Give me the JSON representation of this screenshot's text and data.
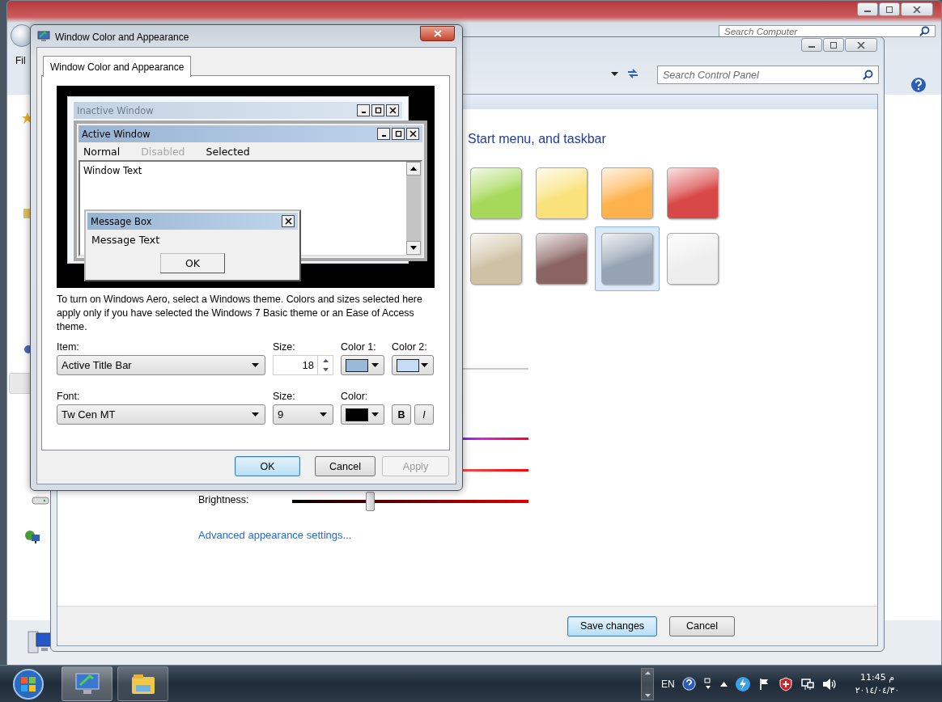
{
  "background_window": {
    "menu_partial": "Fil",
    "search": {
      "placeholder": "Search Computer"
    }
  },
  "control_panel": {
    "search": {
      "placeholder": "Search Control Panel"
    },
    "heading": "Start menu, and taskbar",
    "swatches": [
      {
        "color": "#a6d95a",
        "selected": false
      },
      {
        "color": "#f9e27a",
        "selected": false
      },
      {
        "color": "#fdb24e",
        "selected": false
      },
      {
        "color": "#d94848",
        "selected": false
      },
      {
        "color": "#cfc2a4",
        "selected": false
      },
      {
        "color": "#8a6462",
        "selected": false
      },
      {
        "color": "#95a3b3",
        "selected": true
      },
      {
        "color": "#eeeeee",
        "selected": false
      }
    ],
    "brightness": {
      "label": "Brightness:",
      "level": 0.33
    },
    "link": "Advanced appearance settings...",
    "buttons": [
      {
        "label": "Save changes",
        "default": true
      },
      {
        "label": "Cancel",
        "default": false
      }
    ]
  },
  "dialog": {
    "title": "Window Color and Appearance",
    "tabs": [
      {
        "label": "Window Color and Appearance",
        "selected": true
      }
    ],
    "preview": {
      "inactive_title": "Inactive Window",
      "active_title": "Active Window",
      "menu": [
        {
          "label": "Normal",
          "disabled": false
        },
        {
          "label": "Disabled",
          "disabled": true
        },
        {
          "label": "Selected",
          "disabled": false
        }
      ],
      "window_text": "Window Text",
      "message_box": {
        "title": "Message Box",
        "text": "Message Text",
        "button": "OK"
      }
    },
    "note": "To turn on Windows Aero, select a Windows theme.  Colors and sizes selected here apply only if you have selected the Windows 7 Basic theme or an Ease of Access theme.",
    "item": {
      "label": "Item:",
      "value": "Active Title Bar"
    },
    "item_size": {
      "label": "Size:",
      "value": "18"
    },
    "color1": {
      "label": "Color 1:",
      "color": "#9ab8d8"
    },
    "color2": {
      "label": "Color 2:",
      "color": "#c4dcf4"
    },
    "font": {
      "label": "Font:",
      "value": "Tw Cen MT"
    },
    "font_size": {
      "label": "Size:",
      "value": "9"
    },
    "font_color": {
      "label": "Color:",
      "color": "#000000"
    },
    "bold": {
      "label": "B",
      "on": false
    },
    "italic": {
      "label": "I",
      "on": false
    },
    "buttons": [
      {
        "label": "OK",
        "default": true,
        "disabled": false
      },
      {
        "label": "Cancel",
        "default": false,
        "disabled": false
      },
      {
        "label": "Apply",
        "default": false,
        "disabled": true
      }
    ]
  },
  "taskbar": {
    "language": "EN",
    "time": "11:45 م",
    "date": "٢٠١٤/٠٤/٣٠"
  }
}
